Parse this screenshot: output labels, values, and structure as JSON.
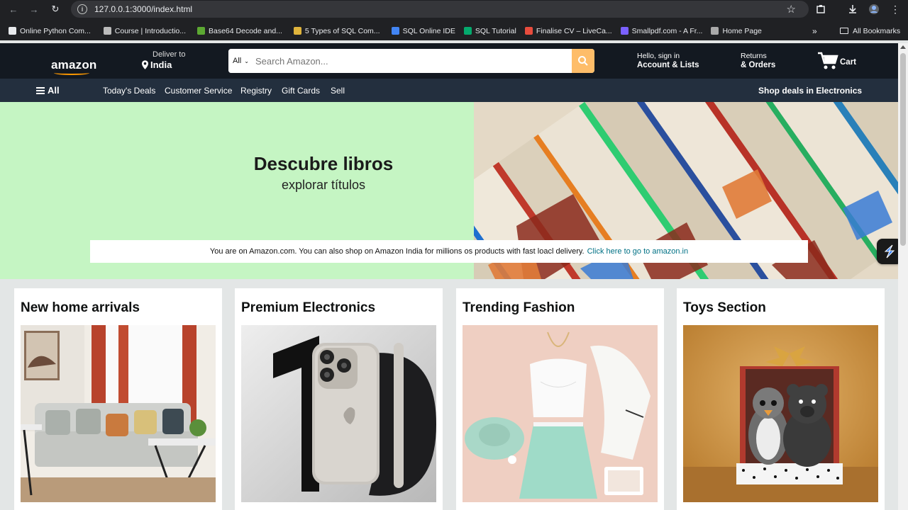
{
  "browser": {
    "url": "127.0.0.1:3000/index.html",
    "bookmarks": [
      {
        "label": "Online Python Com...",
        "color": "#e8eaed"
      },
      {
        "label": "Course | Introductio...",
        "color": "#bbbbbb"
      },
      {
        "label": "Base64 Decode and...",
        "color": "#5ca832"
      },
      {
        "label": "5 Types of SQL Com...",
        "color": "#e0b43c"
      },
      {
        "label": "SQL Online IDE",
        "color": "#4285f4"
      },
      {
        "label": "SQL Tutorial",
        "color": "#04aa6d"
      },
      {
        "label": "Finalise CV – LiveCa...",
        "color": "#e84c3d"
      },
      {
        "label": "Smallpdf.com - A Fr...",
        "color": "#7b61ff"
      },
      {
        "label": "Home Page",
        "color": "#aaaaaa"
      }
    ],
    "more_label": "»",
    "all_bookmarks": "All Bookmarks"
  },
  "header": {
    "logo": "amazon",
    "deliver_label": "Deliver to",
    "deliver_location": "India",
    "search_category": "All",
    "search_placeholder": "Search Amazon...",
    "account_greeting": "Hello, sign in",
    "account_label": "Account & Lists",
    "returns_label": "Returns",
    "orders_label": "& Orders",
    "cart_label": "Cart"
  },
  "subnav": {
    "all_label": "All",
    "items": [
      "Today's Deals",
      "Customer Service",
      "Registry",
      "Gift Cards",
      "Sell"
    ],
    "deals_label": "Shop deals in Electronics"
  },
  "hero": {
    "title": "Descubre libros",
    "subtitle": "explorar títulos",
    "notice": "You are on Amazon.com. You can also shop on Amazon India for millions os products with fast loacl delivery.",
    "notice_link": "Click here to go to amazon.in"
  },
  "cards": [
    {
      "title": "New home arrivals"
    },
    {
      "title": "Premium Electronics"
    },
    {
      "title": "Trending Fashion"
    },
    {
      "title": "Toys Section"
    }
  ],
  "colors": {
    "nav_bg": "#131921",
    "subnav_bg": "#232f3e",
    "search_btn": "#febd69",
    "hero_bg": "#c5f5c3",
    "accent": "#ff9900"
  }
}
